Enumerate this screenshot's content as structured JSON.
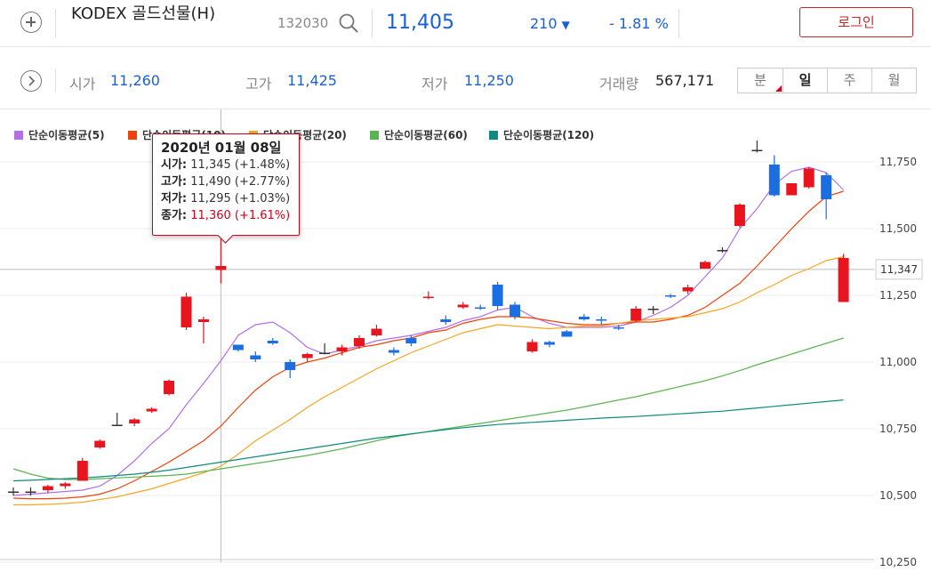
{
  "header": {
    "name": "KODEX 골드선물(H)",
    "code": "132030",
    "price": "11,405",
    "change": "210",
    "change_pct": "- 1.81 %",
    "login_label": "로그인"
  },
  "summary": {
    "open_label": "시가",
    "open": "11,260",
    "high_label": "고가",
    "high": "11,425",
    "low_label": "저가",
    "low": "11,250",
    "volume_label": "거래량",
    "volume": "567,171"
  },
  "periods": [
    {
      "label": "분",
      "active": false
    },
    {
      "label": "일",
      "active": true
    },
    {
      "label": "주",
      "active": false
    },
    {
      "label": "월",
      "active": false
    }
  ],
  "colors": {
    "up": "#e8141e",
    "down": "#1a6ee0",
    "flat": "#333333"
  },
  "tooltip": {
    "date": "2020년 01월 08일",
    "rows": [
      {
        "label": "시가:",
        "value": "11,345 (+1.48%)",
        "red": false
      },
      {
        "label": "고가:",
        "value": "11,490 (+2.77%)",
        "red": false
      },
      {
        "label": "저가:",
        "value": "11,295 (+1.03%)",
        "red": false
      },
      {
        "label": "종가:",
        "value": "11,360 (+1.61%)",
        "red": true
      }
    ]
  },
  "crosshair_value": "11,347",
  "chart_data": {
    "type": "candlestick",
    "ylim": [
      10250,
      11900
    ],
    "yticks": [
      10250,
      10500,
      10750,
      11000,
      11250,
      11500,
      11750
    ],
    "ytick_labels": [
      "10,250",
      "10,500",
      "10,750",
      "11,000",
      "11,250",
      "11,500",
      "11,750"
    ],
    "grid": true,
    "legend": "top-left",
    "candles": [
      {
        "o": 10515,
        "h": 10530,
        "l": 10500,
        "c": 10515
      },
      {
        "o": 10515,
        "h": 10530,
        "l": 10500,
        "c": 10515
      },
      {
        "o": 10520,
        "h": 10540,
        "l": 10510,
        "c": 10535
      },
      {
        "o": 10535,
        "h": 10550,
        "l": 10525,
        "c": 10545
      },
      {
        "o": 10555,
        "h": 10640,
        "l": 10555,
        "c": 10630
      },
      {
        "o": 10680,
        "h": 10710,
        "l": 10675,
        "c": 10705
      },
      {
        "o": 10765,
        "h": 10810,
        "l": 10760,
        "c": 10765
      },
      {
        "o": 10770,
        "h": 10790,
        "l": 10760,
        "c": 10785
      },
      {
        "o": 10815,
        "h": 10830,
        "l": 10810,
        "c": 10825
      },
      {
        "o": 10880,
        "h": 10935,
        "l": 10875,
        "c": 10930
      },
      {
        "o": 11130,
        "h": 11260,
        "l": 11120,
        "c": 11245
      },
      {
        "o": 11150,
        "h": 11170,
        "l": 11070,
        "c": 11160
      },
      {
        "o": 11345,
        "h": 11490,
        "l": 11295,
        "c": 11360
      },
      {
        "o": 11065,
        "h": 11065,
        "l": 11040,
        "c": 11045
      },
      {
        "o": 11025,
        "h": 11040,
        "l": 11000,
        "c": 11010
      },
      {
        "o": 11080,
        "h": 11090,
        "l": 11065,
        "c": 11070
      },
      {
        "o": 11000,
        "h": 11010,
        "l": 10940,
        "c": 10970
      },
      {
        "o": 11015,
        "h": 11035,
        "l": 11000,
        "c": 11030
      },
      {
        "o": 11035,
        "h": 11070,
        "l": 11030,
        "c": 11035
      },
      {
        "o": 11040,
        "h": 11065,
        "l": 11025,
        "c": 11055
      },
      {
        "o": 11060,
        "h": 11100,
        "l": 11050,
        "c": 11090
      },
      {
        "o": 11100,
        "h": 11140,
        "l": 11095,
        "c": 11125
      },
      {
        "o": 11045,
        "h": 11055,
        "l": 11025,
        "c": 11035
      },
      {
        "o": 11090,
        "h": 11100,
        "l": 11060,
        "c": 11070
      },
      {
        "o": 11240,
        "h": 11265,
        "l": 11235,
        "c": 11245
      },
      {
        "o": 11160,
        "h": 11175,
        "l": 11140,
        "c": 11150
      },
      {
        "o": 11205,
        "h": 11225,
        "l": 11200,
        "c": 11215
      },
      {
        "o": 11205,
        "h": 11215,
        "l": 11195,
        "c": 11200
      },
      {
        "o": 11290,
        "h": 11300,
        "l": 11195,
        "c": 11210
      },
      {
        "o": 11215,
        "h": 11225,
        "l": 11160,
        "c": 11170
      },
      {
        "o": 11040,
        "h": 11085,
        "l": 11035,
        "c": 11075
      },
      {
        "o": 11075,
        "h": 11080,
        "l": 11055,
        "c": 11065
      },
      {
        "o": 11115,
        "h": 11120,
        "l": 11095,
        "c": 11095
      },
      {
        "o": 11170,
        "h": 11180,
        "l": 11155,
        "c": 11160
      },
      {
        "o": 11160,
        "h": 11170,
        "l": 11140,
        "c": 11155
      },
      {
        "o": 11130,
        "h": 11140,
        "l": 11120,
        "c": 11125
      },
      {
        "o": 11155,
        "h": 11210,
        "l": 11150,
        "c": 11200
      },
      {
        "o": 11200,
        "h": 11210,
        "l": 11180,
        "c": 11200
      },
      {
        "o": 11250,
        "h": 11255,
        "l": 11240,
        "c": 11245
      },
      {
        "o": 11265,
        "h": 11290,
        "l": 11255,
        "c": 11280
      },
      {
        "o": 11350,
        "h": 11380,
        "l": 11350,
        "c": 11375
      },
      {
        "o": 11420,
        "h": 11430,
        "l": 11410,
        "c": 11420
      },
      {
        "o": 11510,
        "h": 11595,
        "l": 11505,
        "c": 11590
      },
      {
        "o": 11795,
        "h": 11830,
        "l": 11785,
        "c": 11795
      },
      {
        "o": 11740,
        "h": 11775,
        "l": 11620,
        "c": 11625
      },
      {
        "o": 11625,
        "h": 11670,
        "l": 11625,
        "c": 11670
      },
      {
        "o": 11655,
        "h": 11730,
        "l": 11650,
        "c": 11725
      },
      {
        "o": 11700,
        "h": 11710,
        "l": 11535,
        "c": 11610
      },
      {
        "o": 11225,
        "h": 11405,
        "l": 11225,
        "c": 11390
      }
    ],
    "series": [
      {
        "name": "단순이동평균(5)",
        "color": "#b36ee8",
        "values": [
          10500,
          10505,
          10510,
          10515,
          10520,
          10535,
          10575,
          10630,
          10695,
          10750,
          10840,
          10920,
          11005,
          11100,
          11140,
          11150,
          11110,
          11055,
          11030,
          11045,
          11060,
          11080,
          11090,
          11100,
          11115,
          11130,
          11155,
          11170,
          11195,
          11205,
          11170,
          11145,
          11130,
          11130,
          11130,
          11135,
          11150,
          11175,
          11205,
          11250,
          11320,
          11390,
          11500,
          11575,
          11665,
          11715,
          11730,
          11710,
          11645
        ]
      },
      {
        "name": "단순이동평균(10)",
        "color": "#f0420a",
        "values": [
          10490,
          10488,
          10488,
          10490,
          10495,
          10505,
          10525,
          10555,
          10590,
          10625,
          10665,
          10705,
          10760,
          10830,
          10895,
          10945,
          10980,
          11000,
          11015,
          11035,
          11055,
          11065,
          11080,
          11090,
          11110,
          11120,
          11145,
          11160,
          11170,
          11170,
          11165,
          11155,
          11145,
          11140,
          11140,
          11145,
          11150,
          11150,
          11160,
          11175,
          11205,
          11250,
          11295,
          11360,
          11430,
          11500,
          11565,
          11620,
          11640
        ]
      },
      {
        "name": "단순이동평균(20)",
        "color": "#f5a623",
        "values": [
          10465,
          10465,
          10467,
          10470,
          10475,
          10485,
          10495,
          10510,
          10525,
          10545,
          10565,
          10585,
          10610,
          10655,
          10705,
          10745,
          10785,
          10830,
          10870,
          10905,
          10940,
          10975,
          11005,
          11035,
          11060,
          11085,
          11110,
          11125,
          11140,
          11135,
          11130,
          11125,
          11130,
          11135,
          11135,
          11145,
          11155,
          11160,
          11165,
          11170,
          11185,
          11200,
          11225,
          11260,
          11290,
          11325,
          11350,
          11380,
          11395
        ]
      },
      {
        "name": "단순이동평균(60)",
        "color": "#5bb450",
        "values": [
          10600,
          10580,
          10565,
          10560,
          10560,
          10563,
          10566,
          10569,
          10572,
          10575,
          10580,
          10590,
          10600,
          10610,
          10620,
          10630,
          10640,
          10650,
          10662,
          10675,
          10690,
          10705,
          10720,
          10730,
          10740,
          10750,
          10760,
          10770,
          10780,
          10790,
          10800,
          10810,
          10820,
          10832,
          10845,
          10858,
          10870,
          10885,
          10900,
          10915,
          10930,
          10948,
          10968,
          10990,
          11010,
          11030,
          11050,
          11070,
          11090
        ]
      },
      {
        "name": "단순이동평균(120)",
        "color": "#0e8a80",
        "values": [
          10555,
          10557,
          10560,
          10563,
          10566,
          10570,
          10575,
          10580,
          10587,
          10595,
          10605,
          10615,
          10625,
          10635,
          10645,
          10655,
          10665,
          10675,
          10685,
          10695,
          10705,
          10715,
          10723,
          10731,
          10739,
          10747,
          10754,
          10760,
          10766,
          10770,
          10774,
          10778,
          10782,
          10786,
          10790,
          10793,
          10796,
          10800,
          10804,
          10808,
          10812,
          10816,
          10822,
          10828,
          10834,
          10840,
          10846,
          10852,
          10858
        ]
      }
    ]
  }
}
